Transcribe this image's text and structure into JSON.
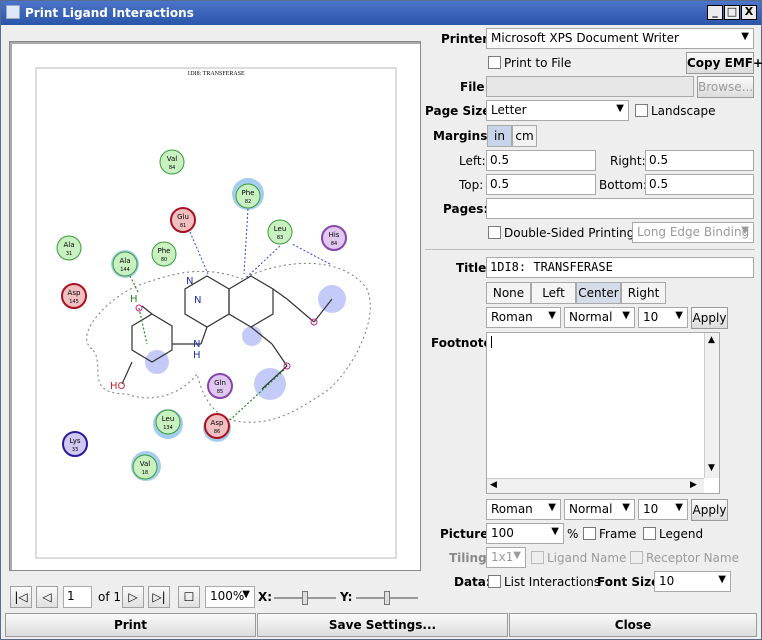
{
  "window": {
    "title": "Print Ligand Interactions",
    "minimize": "_",
    "maximize": "□",
    "close": "X"
  },
  "printer": {
    "label": "Printer:",
    "value": "Microsoft XPS Document Writer",
    "print_to_file": "Print to File",
    "copy_emf": "Copy EMF+"
  },
  "file": {
    "label": "File:",
    "value": "",
    "browse": "Browse..."
  },
  "page_size": {
    "label": "Page Size:",
    "value": "Letter",
    "landscape": "Landscape"
  },
  "margins": {
    "label": "Margins:",
    "unit_in": "in",
    "unit_cm": "cm",
    "left_label": "Left:",
    "left": "0.5",
    "right_label": "Right:",
    "right": "0.5",
    "top_label": "Top:",
    "top": "0.5",
    "bottom_label": "Bottom:",
    "bottom": "0.5"
  },
  "pages": {
    "label": "Pages:",
    "value": "",
    "double_sided": "Double-Sided Printing",
    "binding": "Long Edge Binding"
  },
  "title_section": {
    "label": "Title:",
    "value": "1DI8: TRANSFERASE",
    "align": [
      "None",
      "Left",
      "Center",
      "Right"
    ],
    "font": "Roman",
    "style": "Normal",
    "size": "10",
    "apply": "Apply"
  },
  "footnote": {
    "label": "Footnote:",
    "value": "",
    "font": "Roman",
    "style": "Normal",
    "size": "10",
    "apply": "Apply"
  },
  "picture": {
    "label": "Picture:",
    "value": "100",
    "unit": "%",
    "frame": "Frame",
    "legend": "Legend"
  },
  "tiling": {
    "label": "Tiling:",
    "value": "1x1",
    "ligand_name": "Ligand Name",
    "receptor_name": "Receptor Name"
  },
  "data_row": {
    "label": "Data:",
    "list_interactions": "List Interactions",
    "font_size_label": "Font Size:",
    "font_size": "10"
  },
  "nav": {
    "page": "1",
    "of": "of 1",
    "zoom": "100%",
    "x_label": "X:",
    "y_label": "Y:"
  },
  "buttons": {
    "print": "Print",
    "save_settings": "Save Settings...",
    "close": "Close"
  },
  "diagram": {
    "page_title": "1DI8: TRANSFERASE",
    "residues": [
      {
        "name": "Val",
        "num": "84"
      },
      {
        "name": "Phe",
        "num": "82"
      },
      {
        "name": "Glu",
        "num": "81"
      },
      {
        "name": "Leu",
        "num": "83"
      },
      {
        "name": "His",
        "num": "84"
      },
      {
        "name": "Ala",
        "num": "31"
      },
      {
        "name": "Ala",
        "num": "144"
      },
      {
        "name": "Phe",
        "num": "80"
      },
      {
        "name": "Asp",
        "num": "145"
      },
      {
        "name": "Gln",
        "num": "85"
      },
      {
        "name": "Leu",
        "num": "134"
      },
      {
        "name": "Asp",
        "num": "86"
      },
      {
        "name": "Lys",
        "num": "33"
      },
      {
        "name": "Val",
        "num": "18"
      }
    ],
    "atoms": {
      "n1": "N",
      "n2": "N",
      "nh": "N",
      "h": "H",
      "ho": "HO",
      "h2": "H"
    },
    "colors": {
      "hydrophobic": "#c8f0c0",
      "acidic": "#f0c0c0",
      "polar": "#e0c8f0",
      "basic": "#d0c8f0"
    }
  }
}
